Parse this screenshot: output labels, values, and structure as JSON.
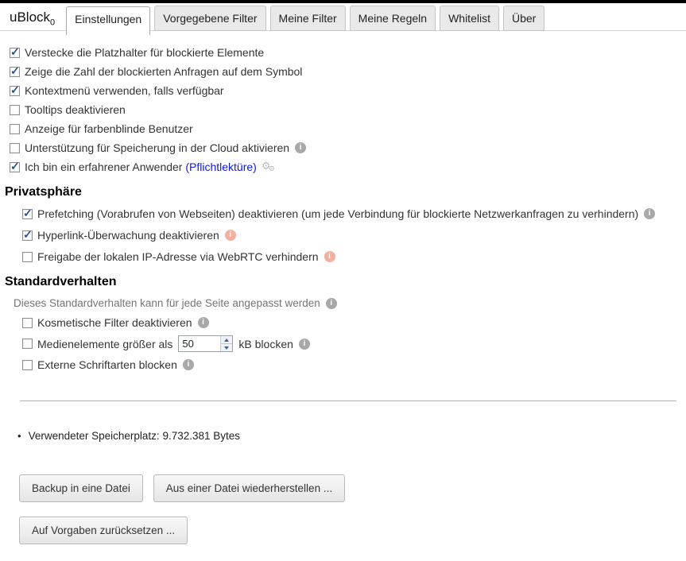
{
  "header": {
    "logo_text": "uBlock",
    "logo_sub": "0",
    "tabs": [
      {
        "label": "Einstellungen",
        "active": true
      },
      {
        "label": "Vorgegebene Filter",
        "active": false
      },
      {
        "label": "Meine Filter",
        "active": false
      },
      {
        "label": "Meine Regeln",
        "active": false
      },
      {
        "label": "Whitelist",
        "active": false
      },
      {
        "label": "Über",
        "active": false
      }
    ]
  },
  "general": {
    "items": [
      {
        "label": "Verstecke die Platzhalter für blockierte Elemente",
        "checked": true
      },
      {
        "label": "Zeige die Zahl der blockierten Anfragen auf dem Symbol",
        "checked": true
      },
      {
        "label": "Kontextmenü verwenden, falls verfügbar",
        "checked": true
      },
      {
        "label": "Tooltips deaktivieren",
        "checked": false
      },
      {
        "label": "Anzeige für farbenblinde Benutzer",
        "checked": false
      },
      {
        "label": "Unterstützung für Speicherung in der Cloud aktivieren",
        "checked": false,
        "info": "gray"
      },
      {
        "label": "Ich bin ein erfahrener Anwender",
        "link": "(Pflichtlektüre)",
        "checked": true
      }
    ]
  },
  "privacy": {
    "title": "Privatsphäre",
    "items": [
      {
        "label": "Prefetching (Vorabrufen von Webseiten) deaktivieren (um jede Verbindung für blockierte Netzwerkanfragen zu verhindern)",
        "checked": true,
        "info": "gray"
      },
      {
        "label": "Hyperlink-Überwachung deaktivieren",
        "checked": true,
        "info": "warn"
      },
      {
        "label": "Freigabe der lokalen IP-Adresse via WebRTC verhindern",
        "checked": false,
        "info": "warn"
      }
    ]
  },
  "behavior": {
    "title": "Standardverhalten",
    "note": "Dieses Standardverhalten kann für jede Seite angepasst werden",
    "items": [
      {
        "label": "Kosmetische Filter deaktivieren",
        "checked": false,
        "info": "gray"
      },
      {
        "label_before": "Medienelemente größer als",
        "value": "50",
        "label_after": "kB blocken",
        "checked": false,
        "info": "gray"
      },
      {
        "label": "Externe Schriftarten blocken",
        "checked": false,
        "info": "gray"
      }
    ]
  },
  "storage": {
    "label": "Verwendeter Speicherplatz:",
    "value": "9.732.381 Bytes"
  },
  "buttons": {
    "backup": "Backup in eine Datei",
    "restore": "Aus einer Datei wiederherstellen ...",
    "reset": "Auf Vorgaben zurücksetzen ..."
  },
  "icons": {
    "info_glyph": "i",
    "gear_glyph": "⚙",
    "check_glyph": "✓",
    "bullet_glyph": "•"
  },
  "colors": {
    "link_blue": "#0e1bd2",
    "check_blue": "#2b5290",
    "info_gray": "#a8a8a8",
    "info_warn": "#f5af9e",
    "tab_inactive_bg": "#e9e9e9"
  }
}
